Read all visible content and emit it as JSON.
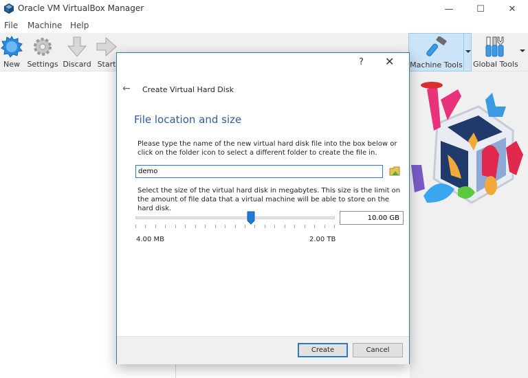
{
  "window": {
    "title": "Oracle VM VirtualBox Manager",
    "controls": {
      "minimize": "—",
      "maximize": "☐",
      "close": "✕"
    }
  },
  "menu": [
    {
      "label": "File"
    },
    {
      "label": "Machine"
    },
    {
      "label": "Help"
    }
  ],
  "toolbar": {
    "items": [
      {
        "label": "New",
        "icon": "new-starburst-icon"
      },
      {
        "label": "Settings",
        "icon": "gear-icon"
      },
      {
        "label": "Discard",
        "icon": "arrow-down-icon"
      },
      {
        "label": "Start",
        "icon": "arrow-right-icon"
      }
    ],
    "machine_tools": {
      "label": "Machine Tools",
      "icon": "hammer-icon",
      "active": true
    },
    "global_tools": {
      "label": "Global Tools",
      "icon": "tools-icon"
    }
  },
  "dialog": {
    "help": "?",
    "close": "✕",
    "back": "←",
    "title": "Create Virtual Hard Disk",
    "section_title": "File location and size",
    "location_text": "Please type the name of the new virtual hard disk file into the box below or click on the folder icon to select a different folder to create the file in.",
    "file_name": "demo",
    "size_text": "Select the size of the virtual hard disk in megabytes. This size is the limit on the amount of file data that a virtual machine will be able to store on the hard disk.",
    "size_value": "10.00 GB",
    "slider": {
      "min_label": "4.00 MB",
      "max_label": "2.00 TB",
      "position_fraction": 0.58,
      "tick_count": 21
    },
    "buttons": {
      "create": "Create",
      "cancel": "Cancel"
    }
  },
  "colors": {
    "accent": "#2b79c2",
    "section_title": "#2e5c9e",
    "active_tool_bg": "#cce4f7"
  }
}
